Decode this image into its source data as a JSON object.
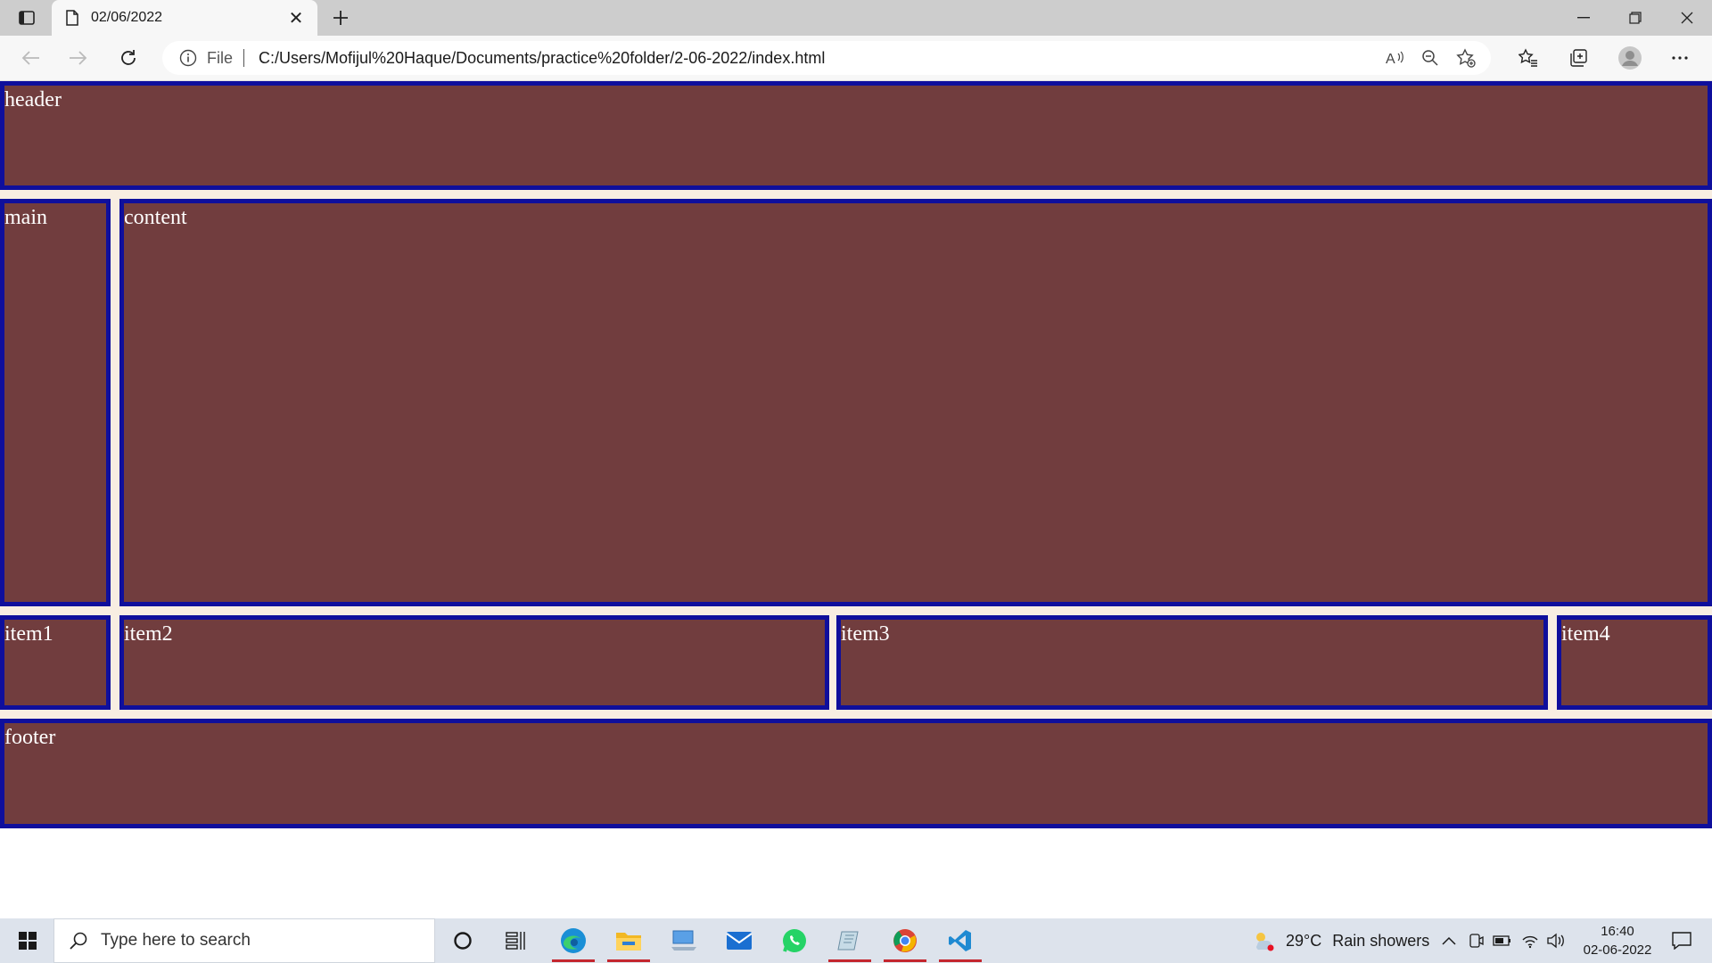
{
  "browser": {
    "tab_title": "02/06/2022",
    "address": {
      "scheme_label": "File",
      "url": "C:/Users/Mofijul%20Haque/Documents/practice%20folder/2-06-2022/index.html"
    },
    "toolbar_icons": [
      "back-icon",
      "forward-icon",
      "refresh-icon",
      "info-icon",
      "read-aloud-icon",
      "zoom-out-icon",
      "add-favorite-icon",
      "favorites-icon",
      "collections-icon",
      "profile-icon",
      "more-icon"
    ]
  },
  "page": {
    "boxes": {
      "header": "header",
      "main": "main",
      "content": "content",
      "item1": "item1",
      "item2": "item2",
      "item3": "item3",
      "item4": "item4",
      "footer": "footer"
    },
    "colors": {
      "box_fill": "#713d3e",
      "box_border": "#0f0f9c",
      "gap_background": "#f8eee2",
      "box_text": "#ffffff"
    }
  },
  "taskbar": {
    "search_placeholder": "Type here to search",
    "weather": {
      "temperature": "29°C",
      "condition": "Rain showers"
    },
    "clock": {
      "time": "16:40",
      "date": "02-06-2022"
    },
    "pinned_apps": [
      "edge-icon",
      "file-explorer-icon",
      "computer-icon",
      "mail-icon",
      "whatsapp-icon",
      "notes-icon",
      "chrome-icon",
      "vscode-icon"
    ]
  }
}
